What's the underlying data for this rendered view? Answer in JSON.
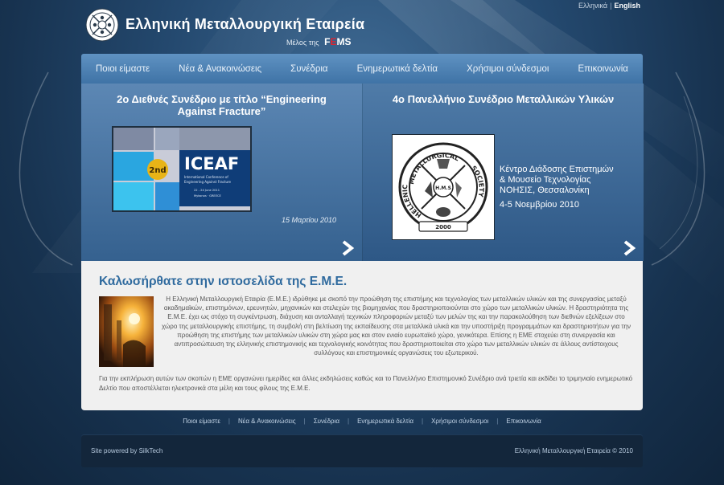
{
  "language": {
    "greek": "Ελληνικά",
    "separator": "|",
    "english": "English"
  },
  "header": {
    "title": "Ελληνική Μεταλλουργική Εταιρεία",
    "member_prefix": "Μέλος της",
    "fems_f": "F",
    "fems_e": "E",
    "fems_rest": "MS"
  },
  "nav": {
    "items": [
      "Ποιοι είμαστε",
      "Νέα & Ανακοινώσεις",
      "Συνέδρια",
      "Ενημερωτικά δελτία",
      "Χρήσιμοι σύνδεσμοι",
      "Επικοινωνία"
    ]
  },
  "features": {
    "left": {
      "title": "2ο Διεθνές Συνέδριο με τίτλο “Engineering Against Fracture”",
      "date": "15 Μαρτίου 2010",
      "image": {
        "logo_text": "ICEAF",
        "badge": "2nd",
        "line1": "International Conference of",
        "line2": "Engineering Against Fracture",
        "line3": "22 - 24 June 2011",
        "line4": "Mykonos · GREECE"
      }
    },
    "right": {
      "title": "4ο Πανελλήνιο Συνέδριο Μεταλλικών Υλικών",
      "venue_lines": [
        "Κέντρο Διάδοσης Επιστημών",
        "& Μουσείο Τεχνολογίας",
        "ΝΟΗΣΙΣ, Θεσσαλονίκη"
      ],
      "dates": "4-5 Νοεμβρίου 2010",
      "seal": {
        "top": "METALLURGICAL",
        "left": "HELLENIC",
        "right": "SOCIETY",
        "center": "H.M.S",
        "year": "2000"
      }
    }
  },
  "welcome": {
    "title": "Καλωσήρθατε στην ιστοσελίδα της Ε.Μ.Ε.",
    "p1": "Η Ελληνική Μεταλλουργική Εταιρία (Ε.Μ.Ε.) ιδρύθηκε με σκοπό την προώθηση της επιστήμης και τεχνολογίας των μεταλλικών υλικών και της συνεργασίας μεταξύ ακαδημαϊκών, επιστημόνων, ερευνητών, μηχανικών και στελεχών της βιομηχανίας που δραστηριοποιούνται στο χώρο των μεταλλικών υλικών. Η δραστηριότητα της Ε.Μ.Ε. έχει ως στόχο τη συγκέντρωση, διάχυση και ανταλλαγή τεχνικών πληροφοριών μεταξύ των μελών της και την παρακολούθηση των διεθνών εξελίξεων στο χώρο της μεταλλουργικής επιστήμης, τη συμβολή στη βελτίωση της εκπαίδευσης στα μεταλλικά υλικά και την υποστήριξη προγραμμάτων και δραστηριοτήτων για την προώθηση της επιστήμης των μεταλλικών υλικών στη χώρα μας και στον ενιαίο ευρωπαϊκό χώρο, γενικότερα. Επίσης η ΕΜΕ στοχεύει στη συνεργασία και αντιπροσώπευση της ελληνικής επιστημονικής και τεχνολογικής κοινότητας που δραστηριοποιείται στο χώρο των μεταλλικών υλικών σε άλλους αντίστοιχους συλλόγους και επιστημονικές οργανώσεις του εξωτερικού.",
    "p2": "Για την εκπλήρωση αυτών των σκοπών η ΕΜΕ οργανώνει ημερίδες και άλλες εκδηλώσεις καθώς και το Πανελλήνιο Επιστημονικό Συνέδριο ανά τριετία και εκδίδει το τριμηνιαίο ενημερωτικό Δελτίο που αποστέλλεται ηλεκτρονικά στα μέλη και τους φίλους της Ε.Μ.Ε."
  },
  "footer": {
    "nav_items": [
      "Ποιοι είμαστε",
      "Νέα & Ανακοινώσεις",
      "Συνέδρια",
      "Ενημερωτικά δελτία",
      "Χρήσιμοι σύνδεσμοι",
      "Επικοινωνία"
    ],
    "separator": "|",
    "powered": "Site powered by SilkTech",
    "copyright": "Ελληνική Μεταλλουργική Εταιρεία © 2010"
  },
  "colors": {
    "nav": "#4f82b4",
    "title_blue": "#2f6a9e",
    "background": "#1b3a5c",
    "fems_red": "#e0242f"
  },
  "icons": [
    "society-logo-icon",
    "chevron-right-icon"
  ]
}
